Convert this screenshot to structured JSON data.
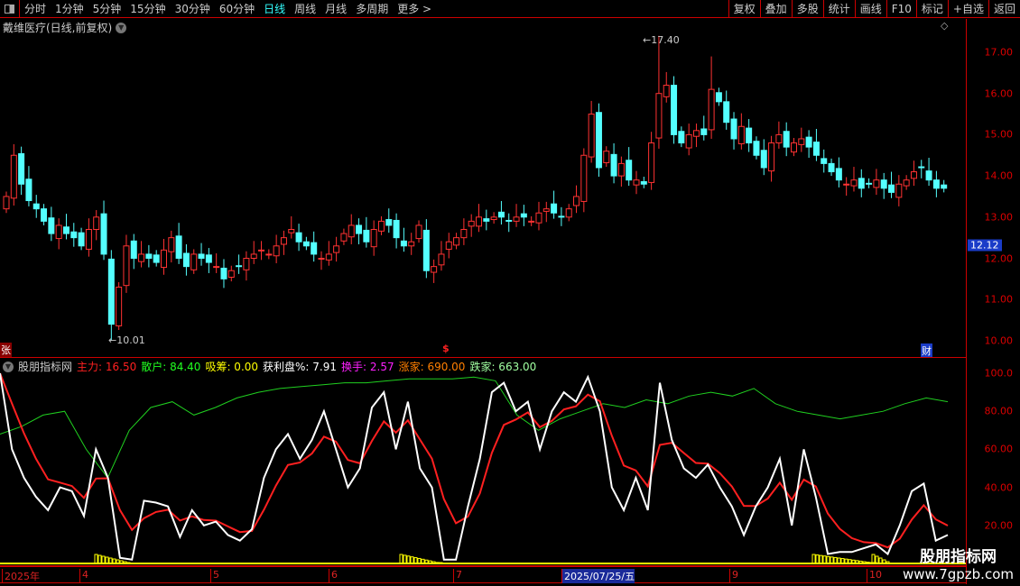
{
  "toolbar": {
    "tabs": [
      "分时",
      "1分钟",
      "5分钟",
      "15分钟",
      "30分钟",
      "60分钟",
      "日线",
      "周线",
      "月线",
      "多周期",
      "更多 >"
    ],
    "active": "日线",
    "right_buttons": [
      "复权",
      "叠加",
      "多股",
      "统计",
      "画线",
      "F10",
      "标记",
      "+自选",
      "返回"
    ]
  },
  "stock_title": "戴维医疗(日线,前复权)",
  "price_axis": [
    "17.00",
    "16.00",
    "15.00",
    "14.00",
    "13.00",
    "12.00",
    "11.00",
    "10.00"
  ],
  "indicator_axis": [
    "100.0",
    "80.00",
    "60.00",
    "40.00",
    "20.00"
  ],
  "current_price": "12.12",
  "markers": {
    "high": "17.40",
    "low": "10.01",
    "zhang": "张",
    "dollar": "$",
    "cai": "财"
  },
  "indicator": {
    "name": "股朋指标网",
    "items": [
      {
        "label": "主力: 16.50",
        "color": "#ff2020"
      },
      {
        "label": "散户: 84.40",
        "color": "#20ff20"
      },
      {
        "label": "吸筹: 0.00",
        "color": "#ffff00"
      },
      {
        "label": "获利盘%: 7.91",
        "color": "#ffffff"
      },
      {
        "label": "换手: 2.57",
        "color": "#ff20ff"
      },
      {
        "label": "涨家: 690.00",
        "color": "#ff7f00"
      },
      {
        "label": "跌家: 663.00",
        "color": "#a0ffa0"
      }
    ]
  },
  "date_axis": [
    "2025年",
    "4",
    "5",
    "6",
    "7",
    "2025/07/25/五",
    "9",
    "10"
  ],
  "watermark": {
    "line1": "股朋指标网",
    "line2": "www.7gpzb.com"
  },
  "chart_data": {
    "type": "candlestick",
    "closes": [
      13.5,
      14.5,
      13.8,
      13.4,
      13.2,
      12.9,
      12.6,
      12.8,
      12.6,
      12.5,
      12.3,
      12.7,
      13.0,
      12.1,
      10.4,
      11.3,
      12.3,
      12.0,
      12.1,
      12.0,
      11.9,
      12.2,
      12.5,
      12.0,
      11.8,
      12.1,
      12.0,
      11.9,
      11.8,
      11.5,
      11.7,
      11.8,
      12.0,
      12.1,
      12.2,
      12.1,
      12.3,
      12.5,
      12.7,
      12.4,
      12.3,
      12.1,
      12.0,
      12.1,
      12.3,
      12.6,
      12.8,
      12.6,
      12.4,
      12.7,
      12.9,
      12.8,
      12.5,
      12.3,
      12.4,
      12.8,
      11.7,
      11.8,
      12.1,
      12.4,
      12.5,
      12.7,
      12.9,
      13.0,
      12.9,
      13.0,
      13.0,
      12.9,
      13.0,
      13.0,
      12.9,
      13.1,
      13.2,
      13.1,
      13.0,
      13.2,
      13.5,
      14.5,
      15.5,
      14.2,
      14.6,
      14.0,
      14.3,
      13.9,
      13.9,
      13.8,
      14.8,
      16.0,
      16.2,
      15.0,
      14.8,
      15.0,
      15.1,
      15.0,
      16.1,
      15.8,
      15.3,
      14.9,
      15.2,
      14.8,
      14.5,
      14.2,
      14.8,
      15.0,
      14.7,
      14.8,
      14.9,
      14.7,
      14.5,
      14.3,
      14.1,
      13.9,
      13.8,
      13.9,
      13.7,
      13.8,
      13.9,
      13.7,
      13.6,
      13.8,
      13.9,
      14.1,
      14.2,
      13.9,
      13.7,
      13.7
    ],
    "white": [
      100,
      60,
      45,
      35,
      28,
      40,
      38,
      25,
      60,
      45,
      3,
      2,
      33,
      32,
      30,
      14,
      28,
      20,
      22,
      15,
      12,
      18,
      45,
      60,
      68,
      55,
      65,
      80,
      60,
      40,
      50,
      82,
      90,
      60,
      85,
      50,
      40,
      2,
      2,
      30,
      55,
      90,
      95,
      80,
      85,
      60,
      80,
      90,
      85,
      98,
      80,
      40,
      28,
      45,
      28,
      95,
      65,
      50,
      45,
      52,
      40,
      30,
      15,
      30,
      40,
      55,
      20,
      60,
      35,
      5,
      6,
      6,
      8,
      10,
      5,
      20,
      38,
      42,
      12,
      15
    ],
    "green": [
      68,
      72,
      78,
      80,
      60,
      45,
      70,
      82,
      85,
      78,
      82,
      87,
      90,
      92,
      93,
      94,
      95,
      95,
      96,
      97,
      97,
      97,
      98,
      96,
      78,
      70,
      76,
      80,
      84,
      82,
      86,
      84,
      88,
      90,
      88,
      92,
      84,
      80,
      78,
      76,
      78,
      80,
      84,
      87,
      85
    ],
    "ylim": [
      10,
      17.4
    ]
  }
}
